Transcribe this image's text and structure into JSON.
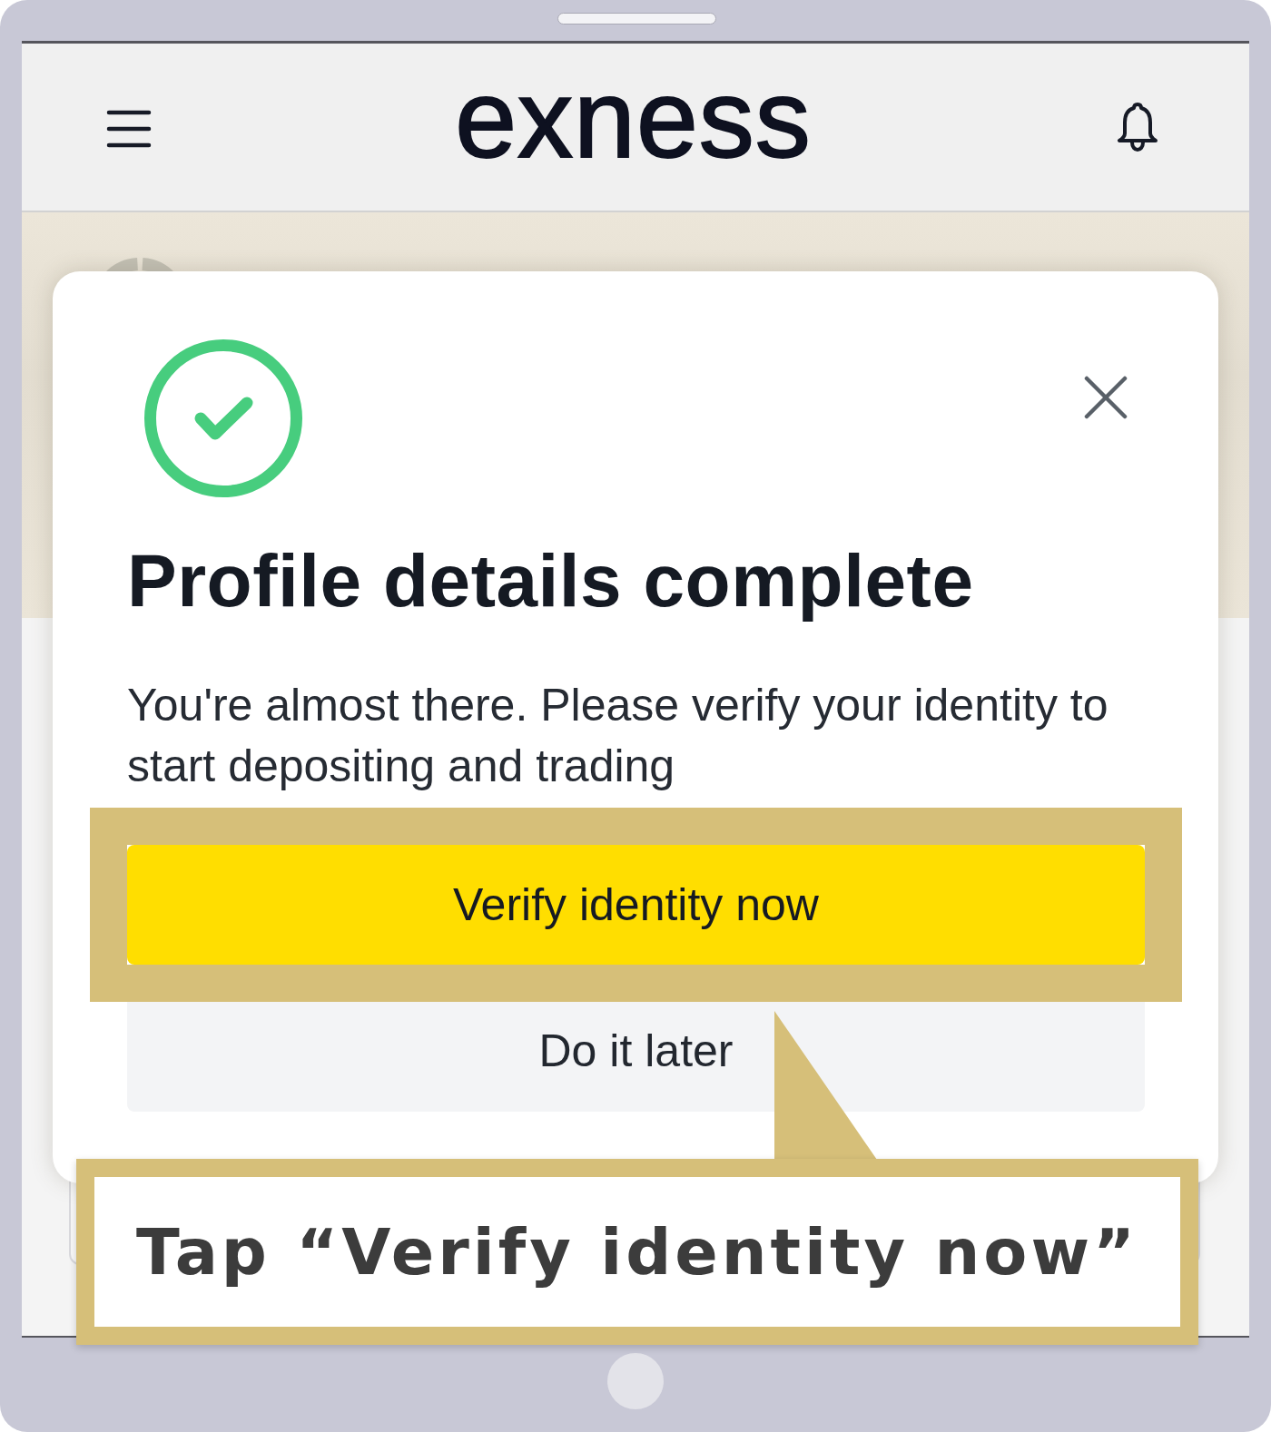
{
  "header": {
    "logo": "exness"
  },
  "dialog": {
    "title": "Profile details complete",
    "message": "You're almost there. Please verify your identity to start depositing and trading",
    "buttons": [
      {
        "label": "Verify identity now",
        "kind": "primary",
        "highlighted": true
      },
      {
        "label": "Do it later",
        "kind": "secondary",
        "highlighted": false
      }
    ]
  },
  "callout": {
    "text": "Tap “Verify identity now”"
  }
}
